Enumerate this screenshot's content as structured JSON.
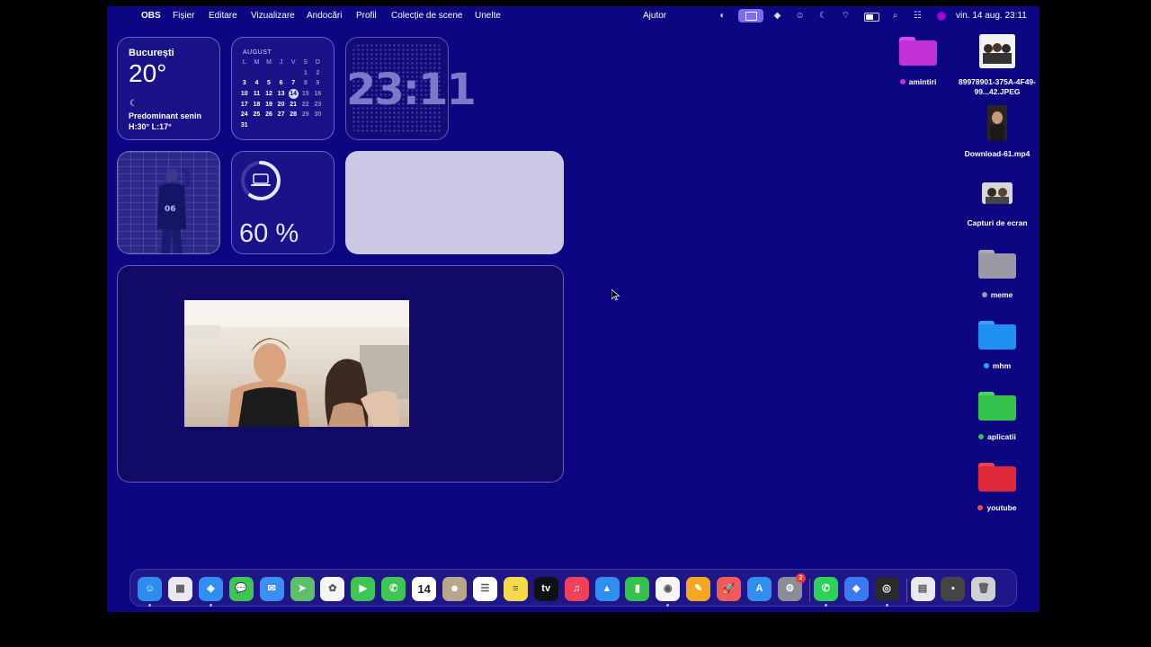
{
  "menubar": {
    "app_name": "OBS",
    "menus": [
      "Fișier",
      "Editare",
      "Vizualizare",
      "Andocări",
      "Profil",
      "Colecție de scene",
      "Unelte"
    ],
    "help": "Ajutor",
    "datetime": "vin. 14 aug.  23:11",
    "status_icons": [
      "obs-icon",
      "screen-share-icon",
      "bluetooth-icon",
      "avatar-icon",
      "moon-icon",
      "wifi-icon",
      "battery-icon",
      "search-icon",
      "control-center-icon",
      "siri-icon"
    ]
  },
  "weather": {
    "city": "București",
    "temperature": "20°",
    "condition": "Predominant senin",
    "high_low": "H:30° L:17°"
  },
  "calendar": {
    "month": "AUGUST",
    "weekdays": [
      "L",
      "M",
      "M",
      "J",
      "V",
      "S",
      "D"
    ],
    "today": "14",
    "weeks": [
      [
        "",
        "",
        "",
        "",
        "",
        "1",
        "2"
      ],
      [
        "3",
        "4",
        "5",
        "6",
        "7",
        "8",
        "9"
      ],
      [
        "10",
        "11",
        "12",
        "13",
        "14",
        "15",
        "16"
      ],
      [
        "17",
        "18",
        "19",
        "20",
        "21",
        "22",
        "23"
      ],
      [
        "24",
        "25",
        "26",
        "27",
        "28",
        "29",
        "30"
      ],
      [
        "31",
        "",
        "",
        "",
        "",
        "",
        ""
      ]
    ]
  },
  "clock": {
    "time": "23:11"
  },
  "battery_widget": {
    "percent_label": "60 %",
    "level": 0.6
  },
  "desktop_icons": [
    {
      "name": "amintiri",
      "kind": "folder",
      "color": "#c231d6",
      "tag": "#c231d6"
    },
    {
      "name": "89978901-375A-4F49-99...42.JPEG",
      "kind": "image"
    },
    {
      "name": "Download-61.mp4",
      "kind": "video"
    },
    {
      "name": "Capturi de ecran",
      "kind": "screenshot"
    },
    {
      "name": "meme",
      "kind": "folder",
      "color": "#9a9aa6",
      "tag": "#9a9aa6"
    },
    {
      "name": "mhm",
      "kind": "folder",
      "color": "#1f8ff0",
      "tag": "#2aa3f5"
    },
    {
      "name": "aplicatii",
      "kind": "folder",
      "color": "#33c24a",
      "tag": "#33c24a"
    },
    {
      "name": "youtube",
      "kind": "folder",
      "color": "#e0283a",
      "tag": "#f04a4a"
    }
  ],
  "dock": {
    "apps": [
      {
        "name": "finder-icon",
        "color": "#2c8cf0",
        "glyph": "☺",
        "running": true
      },
      {
        "name": "launchpad-icon",
        "color": "#e9e9ef",
        "glyph": "▦",
        "running": false
      },
      {
        "name": "safari-icon",
        "color": "#2f8ef0",
        "glyph": "◈",
        "running": true
      },
      {
        "name": "messages-icon",
        "color": "#3fc553",
        "glyph": "💬",
        "running": false
      },
      {
        "name": "mail-icon",
        "color": "#3a8ff5",
        "glyph": "✉",
        "running": false
      },
      {
        "name": "maps-icon",
        "color": "#5cbf6a",
        "glyph": "➤",
        "running": false
      },
      {
        "name": "photos-icon",
        "color": "#f5f5f5",
        "glyph": "✿",
        "running": false
      },
      {
        "name": "facetime-icon",
        "color": "#3fc553",
        "glyph": "▶",
        "running": false
      },
      {
        "name": "phone-icon",
        "color": "#3fc553",
        "glyph": "✆",
        "running": false
      },
      {
        "name": "calendar-icon",
        "color": "#ffffff",
        "glyph": "14",
        "running": false
      },
      {
        "name": "contacts-icon",
        "color": "#b8a68c",
        "glyph": "☻",
        "running": false
      },
      {
        "name": "reminders-icon",
        "color": "#ffffff",
        "glyph": "☰",
        "running": false
      },
      {
        "name": "notes-icon",
        "color": "#f6d94a",
        "glyph": "≡",
        "running": false
      },
      {
        "name": "apple-tv-icon",
        "color": "#111111",
        "glyph": "tv",
        "running": false
      },
      {
        "name": "music-icon",
        "color": "#f0415a",
        "glyph": "♫",
        "running": false
      },
      {
        "name": "keynote-icon",
        "color": "#2f8ef0",
        "glyph": "▲",
        "running": false
      },
      {
        "name": "numbers-icon",
        "color": "#33c24a",
        "glyph": "▮",
        "running": false
      },
      {
        "name": "chrome-icon",
        "color": "#f5f5f5",
        "glyph": "◉",
        "running": true
      },
      {
        "name": "pages-icon",
        "color": "#f5a623",
        "glyph": "✎",
        "running": false
      },
      {
        "name": "rocket-typist-icon",
        "color": "#f05a5a",
        "glyph": "🚀",
        "running": false
      },
      {
        "name": "app-store-icon",
        "color": "#2f8ef0",
        "glyph": "A",
        "running": false
      },
      {
        "name": "system-settings-icon",
        "color": "#8d8d95",
        "glyph": "⚙",
        "running": false,
        "badge": "2"
      }
    ],
    "recent_apps": [
      {
        "name": "whatsapp-icon",
        "color": "#2ed159",
        "glyph": "✆",
        "running": true
      },
      {
        "name": "remote-desktop-icon",
        "color": "#3a7af0",
        "glyph": "◆",
        "running": false
      },
      {
        "name": "obs-app-icon",
        "color": "#2a2a2a",
        "glyph": "◎",
        "running": true
      }
    ],
    "stack_items": [
      {
        "name": "document-stack-icon",
        "color": "#e9e9ef",
        "glyph": "▤"
      },
      {
        "name": "downloads-stack-icon",
        "color": "#444444",
        "glyph": "▪"
      },
      {
        "name": "trash-icon",
        "color": "#cfcfd6",
        "glyph": "🗑"
      }
    ]
  }
}
